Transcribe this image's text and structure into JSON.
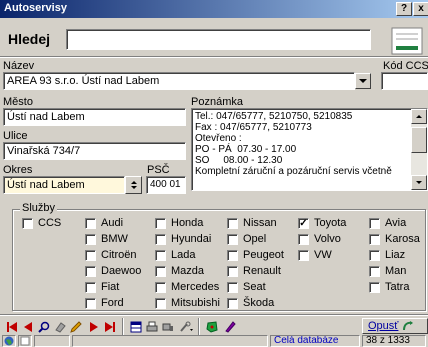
{
  "window": {
    "title": "Autoservisy",
    "help_label": "?",
    "close_label": "x"
  },
  "search": {
    "label": "Hledej",
    "value": ""
  },
  "nazev": {
    "label": "Název",
    "value": "AREA 93 s.r.o. Ústí nad Labem"
  },
  "kod_ccs": {
    "label": "Kód CCS",
    "value": ""
  },
  "mesto": {
    "label": "Město",
    "value": "Ústí nad Labem"
  },
  "ulice": {
    "label": "Ulice",
    "value": "Vinařská 734/7"
  },
  "okres": {
    "label": "Okres",
    "value": "Ústí nad Labem"
  },
  "psc": {
    "label": "PSČ",
    "value": "400 01"
  },
  "poznamka": {
    "label": "Poznámka",
    "lines": [
      "Tel.: 047/65777, 5210750, 5210835",
      "Fax : 047/65777, 5210773",
      "Otevřeno :",
      "PO - PÁ  07.30 - 17.00",
      "SO     08.00 - 12.30",
      "Kompletní záruční a pozáruční servis včetně"
    ]
  },
  "sluzby": {
    "label": "Služby",
    "ccs": {
      "label": "CCS",
      "checked": false
    },
    "brands": [
      {
        "label": "Audi",
        "checked": false
      },
      {
        "label": "BMW",
        "checked": false
      },
      {
        "label": "Citroën",
        "checked": false
      },
      {
        "label": "Daewoo",
        "checked": false
      },
      {
        "label": "Fiat",
        "checked": false
      },
      {
        "label": "Ford",
        "checked": false
      },
      {
        "label": "Honda",
        "checked": false
      },
      {
        "label": "Hyundai",
        "checked": false
      },
      {
        "label": "Lada",
        "checked": false
      },
      {
        "label": "Mazda",
        "checked": false
      },
      {
        "label": "Mercedes",
        "checked": false
      },
      {
        "label": "Mitsubishi",
        "checked": false
      },
      {
        "label": "Nissan",
        "checked": false
      },
      {
        "label": "Opel",
        "checked": false
      },
      {
        "label": "Peugeot",
        "checked": false
      },
      {
        "label": "Renault",
        "checked": false
      },
      {
        "label": "Seat",
        "checked": false
      },
      {
        "label": "Škoda",
        "checked": false
      },
      {
        "label": "Toyota",
        "checked": true
      },
      {
        "label": "Volvo",
        "checked": false
      },
      {
        "label": "VW",
        "checked": false
      },
      {
        "label": "Avia",
        "checked": false
      },
      {
        "label": "Karosa",
        "checked": false
      },
      {
        "label": "Liaz",
        "checked": false
      },
      {
        "label": "Man",
        "checked": false
      },
      {
        "label": "Tatra",
        "checked": false
      }
    ]
  },
  "toolbar": {
    "icons": [
      "first-record-icon",
      "previous-record-icon",
      "search-icon",
      "eraser-icon",
      "edit-pencil-icon",
      "next-record-icon",
      "last-record-icon",
      "table-view-icon",
      "print-icon",
      "print-setup-icon",
      "tools-icon",
      "map-icon",
      "bookmark-icon"
    ],
    "exit_label": "Opusť"
  },
  "status": {
    "database": "Celá databáze",
    "record": "38 z 1333"
  },
  "colors": {
    "title_start": "#0a246a",
    "title_end": "#a6caf0",
    "okres_bg": "#fff8dc",
    "status_blue": "#0000c0",
    "nav_red": "#c00000",
    "exit_text": "#0000a0"
  }
}
